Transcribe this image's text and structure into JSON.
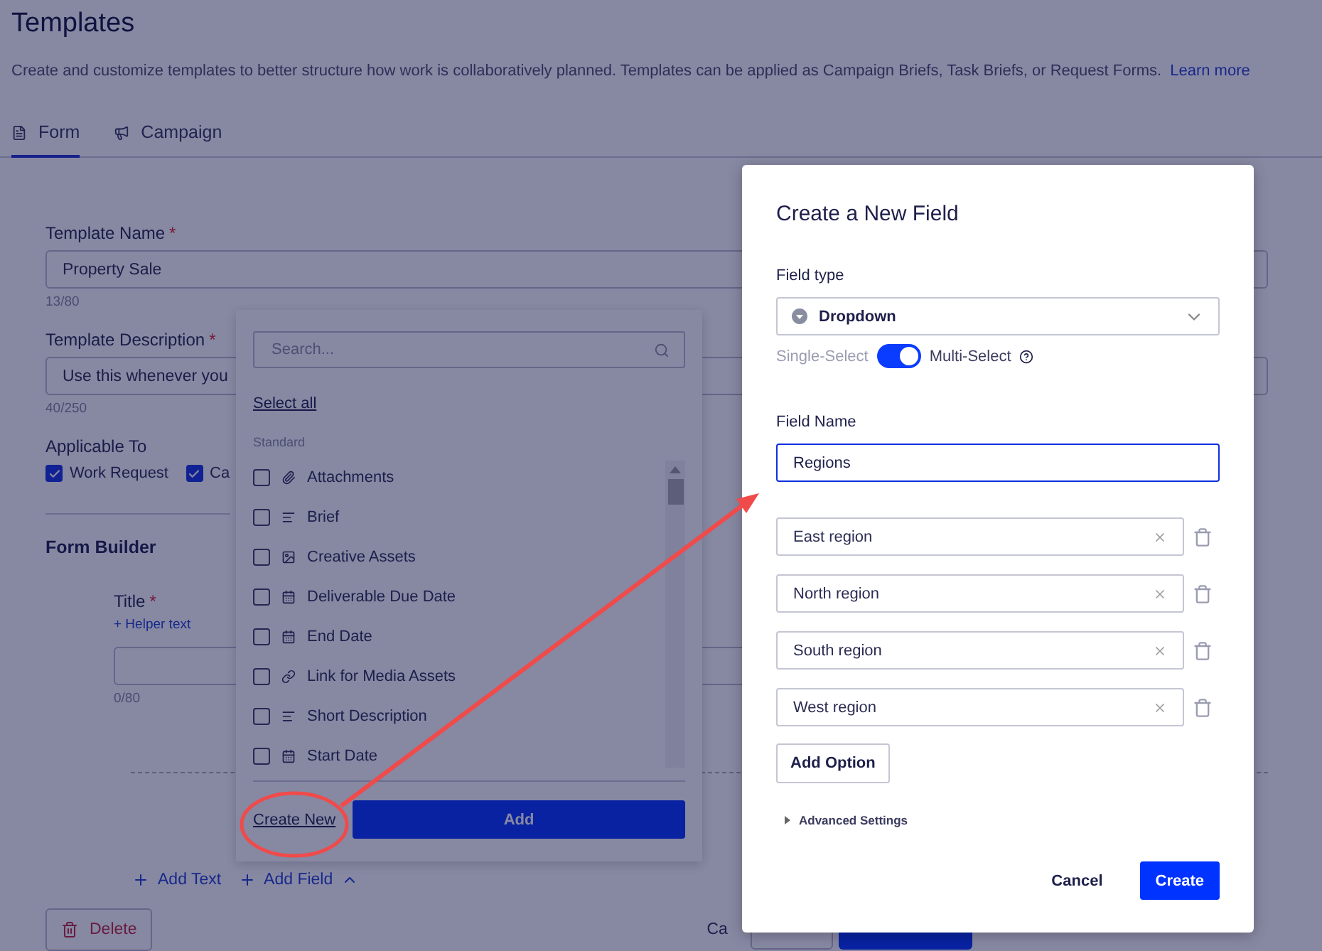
{
  "page": {
    "title": "Templates",
    "description": "Create and customize templates to better structure how work is collaboratively planned. Templates can be applied as Campaign Briefs, Task Briefs, or Request Forms.",
    "learn_more": "Learn more"
  },
  "tabs": [
    {
      "label": "Form",
      "kind": "form",
      "selected": true
    },
    {
      "label": "Campaign",
      "kind": "campaign",
      "selected": false
    }
  ],
  "form": {
    "template_name": {
      "label": "Template Name",
      "required_mark": "*",
      "value": "Property Sale",
      "counter": "13/80"
    },
    "template_description": {
      "label": "Template Description",
      "required_mark": "*",
      "value": "Use this whenever you",
      "counter": "40/250"
    },
    "applicable_to": {
      "label": "Applicable To",
      "options": [
        {
          "label": "Work Request",
          "checked": true
        },
        {
          "label": "Ca",
          "checked": true
        }
      ]
    },
    "form_builder": {
      "heading": "Form Builder",
      "title_field": {
        "label": "Title",
        "required_mark": "*",
        "helper_link": "+ Helper text",
        "counter": "0/80"
      },
      "add_text": "Add Text",
      "add_field": "Add Field"
    },
    "footer": {
      "delete": "Delete",
      "cancel": "Ca"
    }
  },
  "field_picker": {
    "search_placeholder": "Search...",
    "select_all": "Select all",
    "section": "Standard",
    "items": [
      {
        "label": "Attachments",
        "kind": "attachment",
        "checked": false
      },
      {
        "label": "Brief",
        "kind": "text",
        "checked": false
      },
      {
        "label": "Creative Assets",
        "kind": "image",
        "checked": false
      },
      {
        "label": "Deliverable Due Date",
        "kind": "date",
        "checked": false
      },
      {
        "label": "End Date",
        "kind": "date",
        "checked": false
      },
      {
        "label": "Link for Media Assets",
        "kind": "link",
        "checked": false
      },
      {
        "label": "Short Description",
        "kind": "text",
        "checked": false
      },
      {
        "label": "Start Date",
        "kind": "date",
        "checked": false
      }
    ],
    "create_new": "Create New",
    "add": "Add"
  },
  "modal": {
    "title": "Create a New Field",
    "field_type": {
      "label": "Field type",
      "value": "Dropdown"
    },
    "selection_toggle": {
      "off_label": "Single-Select",
      "on_label": "Multi-Select",
      "on": true
    },
    "field_name": {
      "label": "Field Name",
      "value": "Regions"
    },
    "options": [
      {
        "value": "East region"
      },
      {
        "value": "North region"
      },
      {
        "value": "South region"
      },
      {
        "value": "West region"
      }
    ],
    "add_option": "Add Option",
    "advanced_settings": {
      "label": "Advanced Settings",
      "expanded": false
    },
    "cancel": "Cancel",
    "create": "Create"
  }
}
